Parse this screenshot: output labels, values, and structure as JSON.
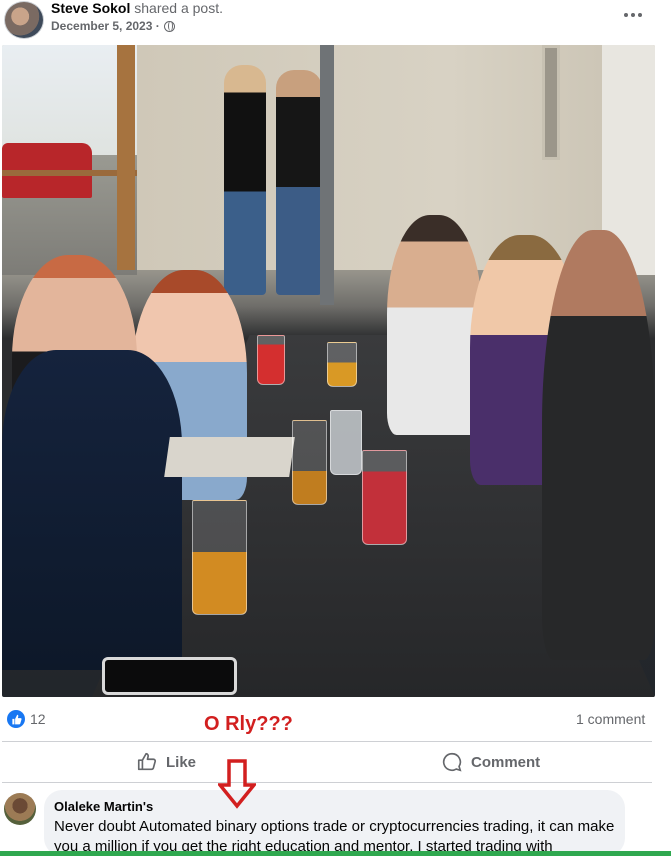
{
  "post": {
    "author": "Steve Sokol",
    "action": " shared a post.",
    "date": "December 5, 2023 ·",
    "privacy_icon": "globe-icon",
    "more_icon": "more-horizontal-icon"
  },
  "reactions": {
    "count": "12",
    "icon": "like-reaction-icon",
    "comment_count": "1 comment"
  },
  "overlay": {
    "text": "O Rly???",
    "color": "#d21f1f"
  },
  "actions": {
    "like_label": "Like",
    "comment_label": "Comment"
  },
  "comment": {
    "author": "Olaleke Martin's",
    "text": "Never doubt Automated binary options trade or cryptocurrencies trading, it can make you a million if you get the right education and mentor, I started trading with"
  },
  "colors": {
    "accent": "#1877f2",
    "annotation_red": "#d21f1f",
    "muted_text": "#65676b"
  }
}
